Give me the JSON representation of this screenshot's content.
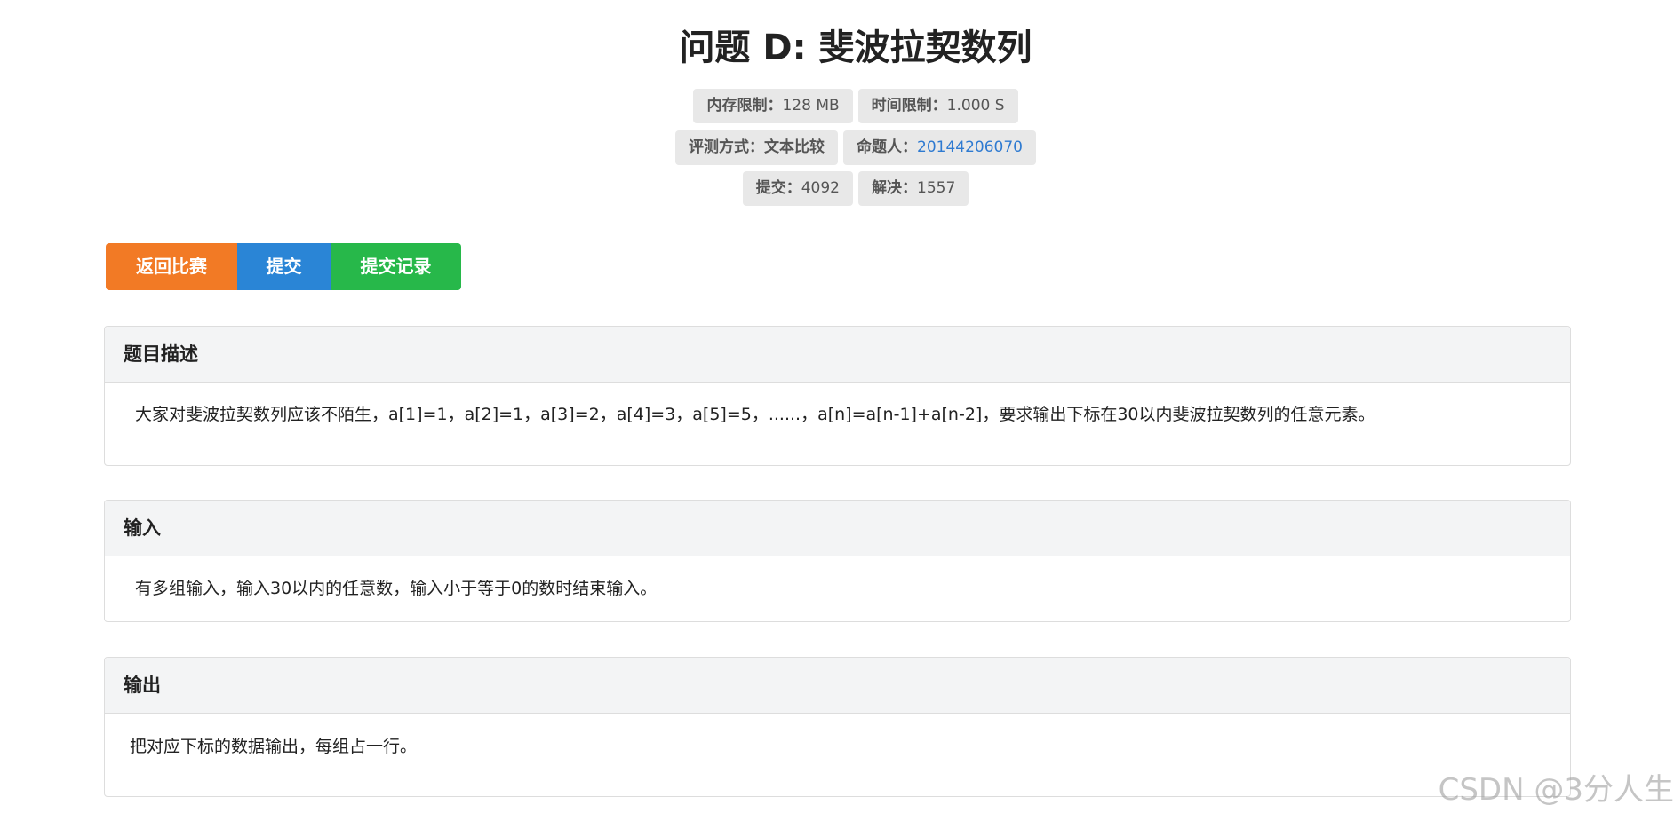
{
  "title": "问题 D: 斐波拉契数列",
  "meta": {
    "memory_key": "内存限制：",
    "memory_val": "128 MB",
    "time_key": "时间限制：",
    "time_val": "1.000 S",
    "judge_key": "评测方式：",
    "judge_val": "文本比较",
    "author_key": "命题人：",
    "author_val": "20144206070",
    "submit_key": "提交：",
    "submit_val": "4092",
    "solved_key": "解决：",
    "solved_val": "1557"
  },
  "buttons": {
    "back": "返回比赛",
    "submit": "提交",
    "records": "提交记录"
  },
  "sections": {
    "description": {
      "heading": "题目描述",
      "body": "大家对斐波拉契数列应该不陌生，a[1]=1，a[2]=1，a[3]=2，a[4]=3，a[5]=5，......，a[n]=a[n-1]+a[n-2]，要求输出下标在30以内斐波拉契数列的任意元素。"
    },
    "input": {
      "heading": "输入",
      "body": "有多组输入，输入30以内的任意数，输入小于等于0的数时结束输入。"
    },
    "output": {
      "heading": "输出",
      "body": "把对应下标的数据输出，每组占一行。"
    }
  },
  "watermark": "CSDN @3分人生",
  "colors": {
    "back_button": "#f27a25",
    "submit_button": "#2a85d6",
    "records_button": "#27b84a",
    "link": "#2e7ad1"
  }
}
